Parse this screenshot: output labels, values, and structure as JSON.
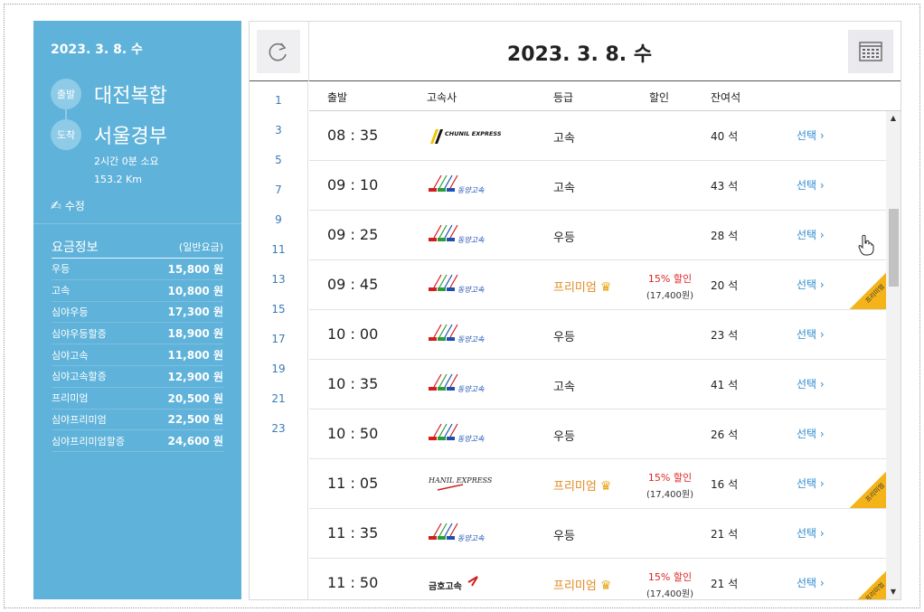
{
  "side": {
    "date": "2023. 3. 8. 수",
    "departure_badge": "출발",
    "departure": "대전복합",
    "arrival_badge": "도착",
    "arrival": "서울경부",
    "duration": "2시간 0분 소요",
    "distance": "153.2 Km",
    "edit_label": "수정",
    "fare_title": "요금정보",
    "fare_sub": "(일반요금)",
    "fares": [
      {
        "name": "우등",
        "price": "15,800 원"
      },
      {
        "name": "고속",
        "price": "10,800 원"
      },
      {
        "name": "심야우등",
        "price": "17,300 원"
      },
      {
        "name": "심야우등할증",
        "price": "18,900 원"
      },
      {
        "name": "심야고속",
        "price": "11,800 원"
      },
      {
        "name": "심야고속할증",
        "price": "12,900 원"
      },
      {
        "name": "프리미엄",
        "price": "20,500 원"
      },
      {
        "name": "심야프리미엄",
        "price": "22,500 원"
      },
      {
        "name": "심야프리미엄할증",
        "price": "24,600 원"
      }
    ]
  },
  "main": {
    "date": "2023. 3. 8. 수",
    "hours": [
      "1",
      "3",
      "5",
      "7",
      "9",
      "11",
      "13",
      "15",
      "17",
      "19",
      "21",
      "23"
    ],
    "headers": {
      "time": "출발",
      "company": "고속사",
      "grade": "등급",
      "discount": "할인",
      "seats": "잔여석"
    },
    "select_label": "선택",
    "premium_tag": "프리미엄",
    "rows": [
      {
        "time": "08 : 35",
        "company": "CHUNIL EXPRESS",
        "grade": "고속",
        "premium": false,
        "discount": "",
        "discount_price": "",
        "seats": "40 석"
      },
      {
        "time": "09 : 10",
        "company": "동양고속",
        "grade": "고속",
        "premium": false,
        "discount": "",
        "discount_price": "",
        "seats": "43 석"
      },
      {
        "time": "09 : 25",
        "company": "동양고속",
        "grade": "우등",
        "premium": false,
        "discount": "",
        "discount_price": "",
        "seats": "28 석"
      },
      {
        "time": "09 : 45",
        "company": "동양고속",
        "grade": "프리미엄",
        "premium": true,
        "discount": "15% 할인",
        "discount_price": "(17,400원)",
        "seats": "20 석"
      },
      {
        "time": "10 : 00",
        "company": "동양고속",
        "grade": "우등",
        "premium": false,
        "discount": "",
        "discount_price": "",
        "seats": "23 석"
      },
      {
        "time": "10 : 35",
        "company": "동양고속",
        "grade": "고속",
        "premium": false,
        "discount": "",
        "discount_price": "",
        "seats": "41 석"
      },
      {
        "time": "10 : 50",
        "company": "동양고속",
        "grade": "우등",
        "premium": false,
        "discount": "",
        "discount_price": "",
        "seats": "26 석"
      },
      {
        "time": "11 : 05",
        "company": "HANIL EXPRESS",
        "grade": "프리미엄",
        "premium": true,
        "discount": "15% 할인",
        "discount_price": "(17,400원)",
        "seats": "16 석"
      },
      {
        "time": "11 : 35",
        "company": "동양고속",
        "grade": "우등",
        "premium": false,
        "discount": "",
        "discount_price": "",
        "seats": "21 석"
      },
      {
        "time": "11 : 50",
        "company": "금호고속",
        "grade": "프리미엄",
        "premium": true,
        "discount": "15% 할인",
        "discount_price": "(17,400원)",
        "seats": "21 석"
      }
    ]
  },
  "colors": {
    "side_bg": "#5fb2d9",
    "link": "#2e8ccf",
    "premium": "#e08a1e",
    "discount": "#e02424",
    "premium_tag": "#f3b319"
  }
}
